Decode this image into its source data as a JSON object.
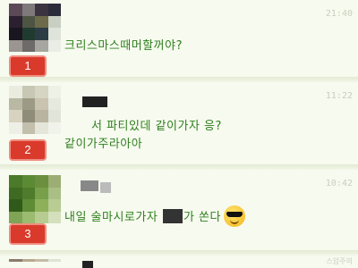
{
  "messages": [
    {
      "badge": "1",
      "time": "21:40",
      "text": "크리스마스때머할꺼야?"
    },
    {
      "badge": "2",
      "time": "11:22",
      "text_line1": "서 파티있데 같이가자 응?",
      "text_line2": "같이가주라아아"
    },
    {
      "badge": "3",
      "time": "10:42",
      "text_part1": "내일 술마시로가자 ",
      "text_part2": "가 쏜다"
    }
  ],
  "watermark": "스압주의",
  "colors": {
    "message_text": "#2e7f1e",
    "badge_bg": "#d93a2b",
    "background": "#f6f9ee",
    "timestamp": "#c8cfbf"
  },
  "icons": {
    "emoji": "sunglasses-face-icon"
  }
}
